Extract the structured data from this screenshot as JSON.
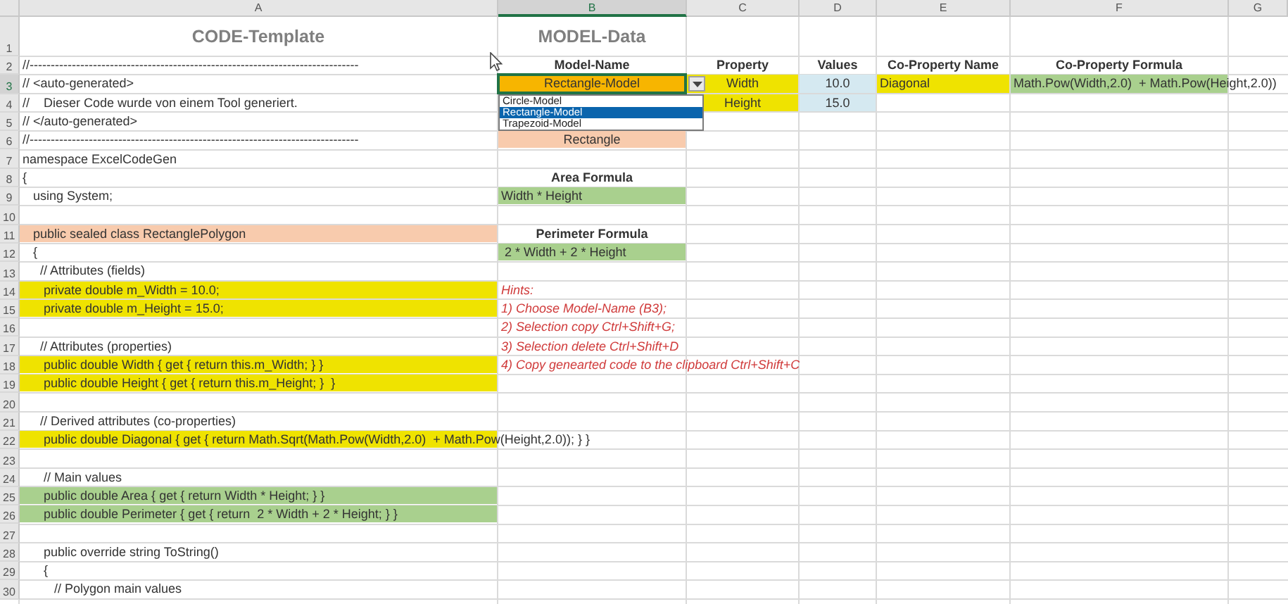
{
  "columns": [
    {
      "label": "A",
      "selected": false
    },
    {
      "label": "B",
      "selected": true
    },
    {
      "label": "C",
      "selected": false
    },
    {
      "label": "D",
      "selected": false
    },
    {
      "label": "E",
      "selected": false
    },
    {
      "label": "F",
      "selected": false
    },
    {
      "label": "G",
      "selected": false
    }
  ],
  "rows": [
    {
      "number": "1",
      "selected": false,
      "cells": [
        {
          "text": "CODE-Template",
          "kind": "title",
          "selected": false
        },
        {
          "text": "MODEL-Data",
          "kind": "title",
          "selected": false
        }
      ]
    },
    {
      "number": "2",
      "selected": false,
      "cells": [
        {
          "text": "//------------------------------------------------------------------------------",
          "kind": "plain",
          "selected": false
        },
        {
          "text": "Model-Name",
          "kind": "label",
          "selected": false
        },
        {
          "text": "Property",
          "kind": "label",
          "selected": false
        },
        {
          "text": "Values",
          "kind": "label",
          "selected": false
        },
        {
          "text": "Co-Property Name",
          "kind": "label",
          "selected": false
        },
        {
          "text": "Co-Property Formula",
          "kind": "label",
          "selected": false
        }
      ]
    },
    {
      "number": "3",
      "selected": true,
      "cells": [
        {
          "text": "// <auto-generated>",
          "kind": "plain",
          "selected": false
        },
        {
          "text": "Rectangle-Model",
          "kind": "centered",
          "color": "#f7b500",
          "selected": true
        },
        {
          "text": "Width",
          "kind": "centered",
          "color": "#efe300",
          "selected": false
        },
        {
          "text": "10.0",
          "kind": "centered",
          "color": "#d5e9f1",
          "selected": false
        },
        {
          "text": "Diagonal",
          "kind": "plain",
          "color": "#efe300",
          "selected": false
        },
        {
          "text": "Math.Pow(Width,2.0)  + Math.Pow(Height,2.0))",
          "kind": "plain",
          "color": "#a9d08e",
          "selected": false
        }
      ]
    },
    {
      "number": "4",
      "selected": false,
      "cells": [
        {
          "text": "//    Dieser Code wurde von einem Tool generiert.",
          "kind": "plain",
          "selected": false
        },
        null,
        {
          "text": "Height",
          "kind": "centered",
          "color": "#efe300",
          "selected": false
        },
        {
          "text": "15.0",
          "kind": "centered",
          "color": "#d5e9f1",
          "selected": false
        }
      ]
    },
    {
      "number": "5",
      "selected": false,
      "cells": [
        {
          "text": "// </auto-generated>",
          "kind": "plain",
          "selected": false
        }
      ]
    },
    {
      "number": "6",
      "selected": false,
      "cells": [
        {
          "text": "//------------------------------------------------------------------------------",
          "kind": "plain",
          "selected": false
        },
        {
          "text": "Rectangle",
          "kind": "centered",
          "color": "#f8cbad",
          "selected": false
        }
      ]
    },
    {
      "number": "7",
      "selected": false,
      "cells": [
        {
          "text": "namespace ExcelCodeGen",
          "kind": "plain",
          "selected": false
        }
      ]
    },
    {
      "number": "8",
      "selected": false,
      "cells": [
        {
          "text": "{",
          "kind": "plain",
          "selected": false
        },
        {
          "text": "Area Formula",
          "kind": "label",
          "selected": false
        }
      ]
    },
    {
      "number": "9",
      "selected": false,
      "cells": [
        {
          "text": "   using System;",
          "kind": "plain",
          "selected": false
        },
        {
          "text": "Width * Height",
          "kind": "plain",
          "color": "#a9d08e",
          "selected": false
        }
      ]
    },
    {
      "number": "10",
      "selected": false,
      "cells": []
    },
    {
      "number": "11",
      "selected": false,
      "cells": [
        {
          "text": "   public sealed class RectanglePolygon",
          "kind": "plain",
          "color": "#f8cbad",
          "selected": false
        },
        {
          "text": "Perimeter Formula",
          "kind": "label",
          "selected": false
        }
      ]
    },
    {
      "number": "12",
      "selected": false,
      "cells": [
        {
          "text": "   {",
          "kind": "plain",
          "selected": false
        },
        {
          "text": " 2 * Width + 2 * Height",
          "kind": "plain",
          "color": "#a9d08e",
          "selected": false
        }
      ]
    },
    {
      "number": "13",
      "selected": false,
      "cells": [
        {
          "text": "     // Attributes (fields)",
          "kind": "plain",
          "selected": false
        }
      ]
    },
    {
      "number": "14",
      "selected": false,
      "cells": [
        {
          "text": "      private double m_Width = 10.0;",
          "kind": "plain",
          "color": "#efe300",
          "selected": false
        },
        {
          "text": "Hints:",
          "kind": "hint",
          "selected": false
        }
      ]
    },
    {
      "number": "15",
      "selected": false,
      "cells": [
        {
          "text": "      private double m_Height = 15.0;",
          "kind": "plain",
          "color": "#efe300",
          "selected": false
        },
        {
          "text": "1) Choose Model-Name (B3);",
          "kind": "hint",
          "selected": false
        }
      ]
    },
    {
      "number": "16",
      "selected": false,
      "cells": [
        null,
        {
          "text": "2) Selection copy Ctrl+Shift+G;",
          "kind": "hint",
          "selected": false
        }
      ]
    },
    {
      "number": "17",
      "selected": false,
      "cells": [
        {
          "text": "     // Attributes (properties)",
          "kind": "plain",
          "selected": false
        },
        {
          "text": "3) Selection delete Ctrl+Shift+D",
          "kind": "hint",
          "selected": false
        }
      ]
    },
    {
      "number": "18",
      "selected": false,
      "cells": [
        {
          "text": "      public double Width { get { return this.m_Width; } }",
          "kind": "plain",
          "color": "#efe300",
          "selected": false
        },
        {
          "text": "4) Copy genearted code to the clipboard Ctrl+Shift+C",
          "kind": "hint",
          "selected": false
        }
      ]
    },
    {
      "number": "19",
      "selected": false,
      "cells": [
        {
          "text": "      public double Height { get { return this.m_Height; }  }",
          "kind": "plain",
          "color": "#efe300",
          "selected": false
        }
      ]
    },
    {
      "number": "20",
      "selected": false,
      "cells": []
    },
    {
      "number": "21",
      "selected": false,
      "cells": [
        {
          "text": "     // Derived attributes (co-properties)",
          "kind": "plain",
          "selected": false
        }
      ]
    },
    {
      "number": "22",
      "selected": false,
      "cells": [
        {
          "text": "      public double Diagonal { get { return Math.Sqrt(Math.Pow(Width,2.0)  + Math.Pow(Height,2.0)); } }",
          "kind": "plain",
          "color": "#efe300",
          "selected": false
        }
      ]
    },
    {
      "number": "23",
      "selected": false,
      "cells": []
    },
    {
      "number": "24",
      "selected": false,
      "cells": [
        {
          "text": "      // Main values",
          "kind": "plain",
          "selected": false
        }
      ]
    },
    {
      "number": "25",
      "selected": false,
      "cells": [
        {
          "text": "      public double Area { get { return Width * Height; } }",
          "kind": "plain",
          "color": "#a9d08e",
          "selected": false
        }
      ]
    },
    {
      "number": "26",
      "selected": false,
      "cells": [
        {
          "text": "      public double Perimeter { get { return  2 * Width + 2 * Height; } }",
          "kind": "plain",
          "color": "#a9d08e",
          "selected": false
        }
      ]
    },
    {
      "number": "27",
      "selected": false,
      "cells": []
    },
    {
      "number": "28",
      "selected": false,
      "cells": [
        {
          "text": "      public override string ToString()",
          "kind": "plain",
          "selected": false
        }
      ]
    },
    {
      "number": "29",
      "selected": false,
      "cells": [
        {
          "text": "      {",
          "kind": "plain",
          "selected": false
        }
      ]
    },
    {
      "number": "30",
      "selected": false,
      "cells": [
        {
          "text": "         // Polygon main values",
          "kind": "plain",
          "selected": false
        }
      ]
    }
  ],
  "dropdown": {
    "options": [
      {
        "label": "Circle-Model",
        "selected": false
      },
      {
        "label": "Rectangle-Model",
        "selected": true
      },
      {
        "label": "Trapezoid-Model",
        "selected": false
      }
    ]
  }
}
